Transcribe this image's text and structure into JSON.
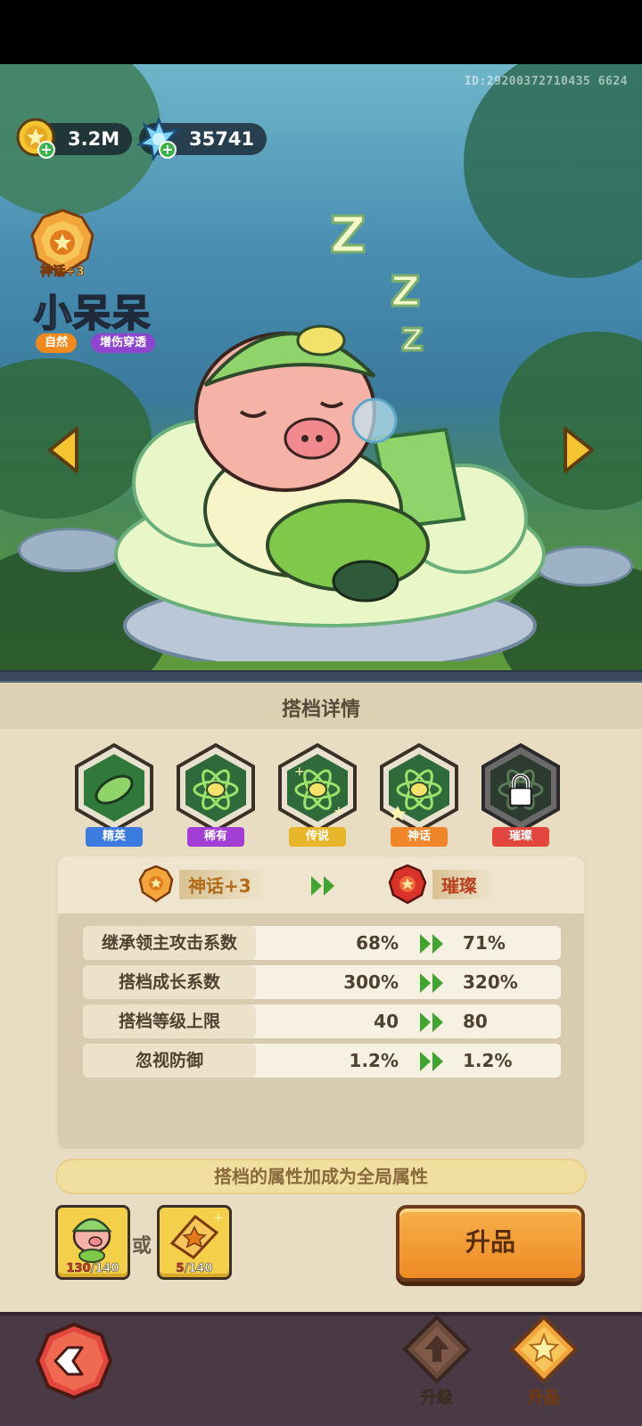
{
  "player_id": "ID:29200372710435 6624",
  "resources": {
    "gold": "3.2M",
    "gems": "35741"
  },
  "hero": {
    "rank_label": "神话+3",
    "name": "小呆呆",
    "tags": [
      "自然",
      "增伤穿透"
    ]
  },
  "panel": {
    "title": "搭档详情",
    "tiers": [
      {
        "label": "精英",
        "color": "#3c7be0"
      },
      {
        "label": "稀有",
        "color": "#a23ed6"
      },
      {
        "label": "传说",
        "color": "#e8b62a"
      },
      {
        "label": "神话",
        "color": "#f0852a"
      },
      {
        "label": "璀璨",
        "color": "#e2463c",
        "locked": true
      }
    ],
    "compare": {
      "from_rank": "神话+3",
      "to_rank": "璀璨",
      "stats": [
        {
          "name": "继承领主攻击系数",
          "from": "68%",
          "to": "71%"
        },
        {
          "name": "搭档成长系数",
          "from": "300%",
          "to": "320%"
        },
        {
          "name": "搭档等级上限",
          "from": "40",
          "to": "80"
        },
        {
          "name": "忽视防御",
          "from": "1.2%",
          "to": "1.2%"
        }
      ]
    },
    "global_note": "搭档的属性加成为全局属性",
    "materials": {
      "item1_have": "130",
      "item1_need": "/140",
      "or_text": "或",
      "item2_have": "5",
      "item2_need": "/140"
    },
    "upgrade_label": "升品"
  },
  "bottom_nav": {
    "levelup_label": "升级",
    "rankup_label": "升品"
  }
}
